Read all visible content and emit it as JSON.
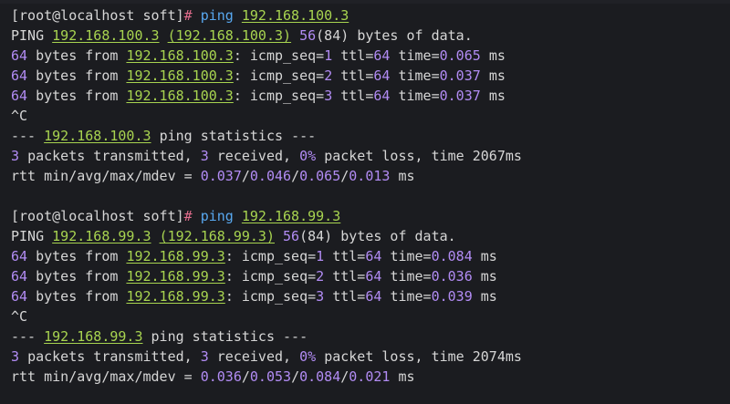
{
  "terminal": {
    "session1": {
      "prompt": "[root@localhost soft]",
      "prompt_hash": "#",
      "command": "ping",
      "target": "192.168.100.3",
      "header": {
        "prefix": "PING",
        "ip": "192.168.100.3",
        "ip_paren": "(192.168.100.3)",
        "size": "56",
        "size_full": "(84)",
        "suffix": "bytes of data."
      },
      "replies": [
        {
          "bytes": "64",
          "from": "bytes from",
          "ip": "192.168.100.3",
          "seq_label": "icmp_seq=",
          "seq": "1",
          "ttl_label": "ttl=",
          "ttl": "64",
          "time_label": "time=",
          "time": "0.065",
          "unit": "ms"
        },
        {
          "bytes": "64",
          "from": "bytes from",
          "ip": "192.168.100.3",
          "seq_label": "icmp_seq=",
          "seq": "2",
          "ttl_label": "ttl=",
          "ttl": "64",
          "time_label": "time=",
          "time": "0.037",
          "unit": "ms"
        },
        {
          "bytes": "64",
          "from": "bytes from",
          "ip": "192.168.100.3",
          "seq_label": "icmp_seq=",
          "seq": "3",
          "ttl_label": "ttl=",
          "ttl": "64",
          "time_label": "time=",
          "time": "0.037",
          "unit": "ms"
        }
      ],
      "interrupt": "^C",
      "stats_title": {
        "dashes_left": "---",
        "ip": "192.168.100.3",
        "label": "ping statistics",
        "dashes_right": "---"
      },
      "stats_line": {
        "transmitted": "3",
        "t_label": "packets transmitted,",
        "received": "3",
        "r_label": "received,",
        "loss": "0%",
        "loss_label": "packet loss, time",
        "time": "2067ms"
      },
      "rtt": {
        "label": "rtt min/avg/max/mdev =",
        "min": "0.037",
        "avg": "0.046",
        "max": "0.065",
        "mdev": "0.013",
        "unit": "ms"
      }
    },
    "session2": {
      "prompt": "[root@localhost soft]",
      "prompt_hash": "#",
      "command": "ping",
      "target": "192.168.99.3",
      "header": {
        "prefix": "PING",
        "ip": "192.168.99.3",
        "ip_paren": "(192.168.99.3)",
        "size": "56",
        "size_full": "(84)",
        "suffix": "bytes of data."
      },
      "replies": [
        {
          "bytes": "64",
          "from": "bytes from",
          "ip": "192.168.99.3",
          "seq_label": "icmp_seq=",
          "seq": "1",
          "ttl_label": "ttl=",
          "ttl": "64",
          "time_label": "time=",
          "time": "0.084",
          "unit": "ms"
        },
        {
          "bytes": "64",
          "from": "bytes from",
          "ip": "192.168.99.3",
          "seq_label": "icmp_seq=",
          "seq": "2",
          "ttl_label": "ttl=",
          "ttl": "64",
          "time_label": "time=",
          "time": "0.036",
          "unit": "ms"
        },
        {
          "bytes": "64",
          "from": "bytes from",
          "ip": "192.168.99.3",
          "seq_label": "icmp_seq=",
          "seq": "3",
          "ttl_label": "ttl=",
          "ttl": "64",
          "time_label": "time=",
          "time": "0.039",
          "unit": "ms"
        }
      ],
      "interrupt": "^C",
      "stats_title": {
        "dashes_left": "---",
        "ip": "192.168.99.3",
        "label": "ping statistics",
        "dashes_right": "---"
      },
      "stats_line": {
        "transmitted": "3",
        "t_label": "packets transmitted,",
        "received": "3",
        "r_label": "received,",
        "loss": "0%",
        "loss_label": "packet loss, time",
        "time": "2074ms"
      },
      "rtt": {
        "label": "rtt min/avg/max/mdev =",
        "min": "0.036",
        "avg": "0.053",
        "max": "0.084",
        "mdev": "0.021",
        "unit": "ms"
      }
    }
  },
  "colors": {
    "background": "#1b1c20",
    "text": "#d6d6d6",
    "ip": "#a8d450",
    "command": "#58a8f0",
    "number": "#b28cf4",
    "prompt_hash": "#e06c8c"
  }
}
